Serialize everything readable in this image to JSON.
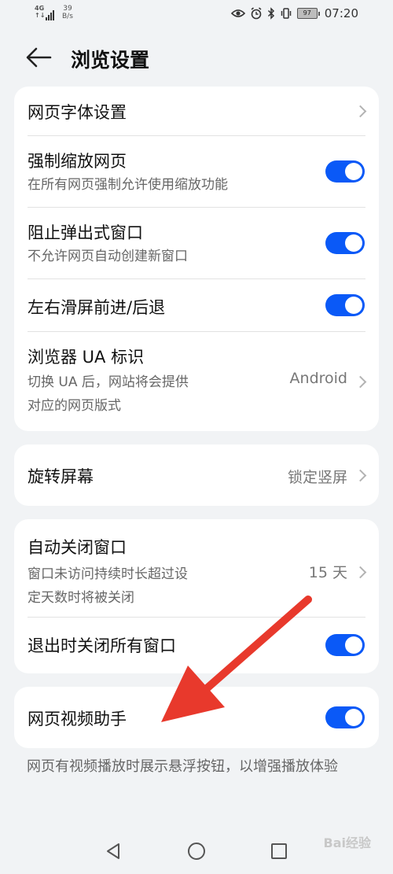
{
  "status_bar": {
    "network_type_top": "4G",
    "network_type_bottom": "↑↓",
    "speed_value": "39",
    "speed_unit": "B/s",
    "battery_level": "97",
    "time": "07:20",
    "icons": [
      "eye-icon",
      "alarm-icon",
      "bluetooth-icon",
      "vibrate-icon"
    ]
  },
  "header": {
    "title": "浏览设置"
  },
  "card1": {
    "font_settings": {
      "title": "网页字体设置"
    },
    "force_zoom": {
      "title": "强制缩放网页",
      "subtitle": "在所有网页强制允许使用缩放功能",
      "enabled": true
    },
    "block_popups": {
      "title": "阻止弹出式窗口",
      "subtitle": "不允许网页自动创建新窗口",
      "enabled": true
    },
    "swipe_nav": {
      "title": "左右滑屏前进/后退",
      "enabled": true
    },
    "ua": {
      "title": "浏览器 UA 标识",
      "subtitle_line1": "切换 UA 后，网站将会提供",
      "subtitle_line2": "对应的网页版式",
      "value": "Android"
    }
  },
  "card2": {
    "rotate": {
      "title": "旋转屏幕",
      "value": "锁定竖屏"
    }
  },
  "card3": {
    "auto_close": {
      "title": "自动关闭窗口",
      "subtitle_line1": "窗口未访问持续时长超过设",
      "subtitle_line2": "定天数时将被关闭",
      "value": "15 天"
    },
    "close_on_exit": {
      "title": "退出时关闭所有窗口",
      "enabled": true
    }
  },
  "card4": {
    "video_assistant": {
      "title": "网页视频助手",
      "enabled": true
    }
  },
  "footer_note": "网页有视频播放时展示悬浮按钮，以增强播放体验",
  "watermark": "Bai经验",
  "colors": {
    "toggle_on": "#0a59f7",
    "annotation_arrow": "#e8392c",
    "background": "#f1f3f5"
  }
}
